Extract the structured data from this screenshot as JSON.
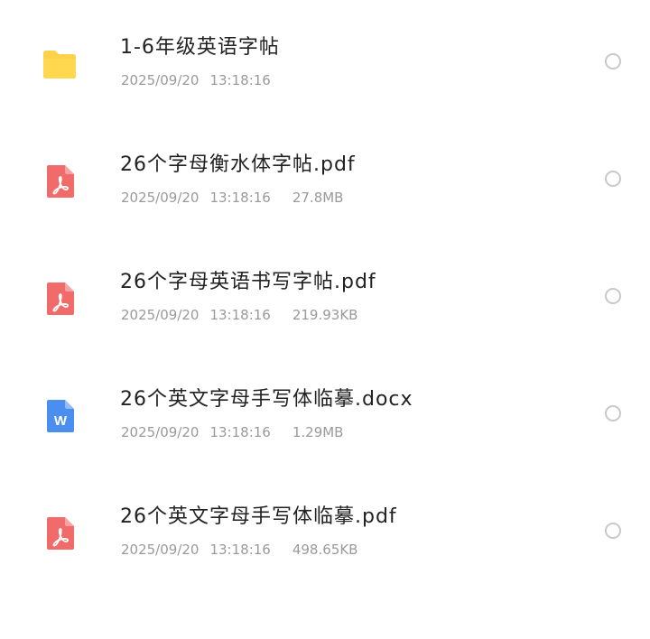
{
  "colors": {
    "folder": "#fdd24a",
    "pdf": "#f26b6b",
    "doc": "#4a8ef0",
    "text_primary": "#222222",
    "text_secondary": "#9a9a9a",
    "radio_border": "#c8c8c8"
  },
  "files": [
    {
      "name": "1-6年级英语字帖",
      "date": "2025/09/20",
      "time": "13:18:16",
      "size": "",
      "icon": "folder-icon"
    },
    {
      "name": "26个字母衡水体字帖.pdf",
      "date": "2025/09/20",
      "time": "13:18:16",
      "size": "27.8MB",
      "icon": "pdf-icon"
    },
    {
      "name": "26个字母英语书写字帖.pdf",
      "date": "2025/09/20",
      "time": "13:18:16",
      "size": "219.93KB",
      "icon": "pdf-icon"
    },
    {
      "name": "26个英文字母手写体临摹.docx",
      "date": "2025/09/20",
      "time": "13:18:16",
      "size": "1.29MB",
      "icon": "word-doc-icon",
      "icon_letter": "W"
    },
    {
      "name": "26个英文字母手写体临摹.pdf",
      "date": "2025/09/20",
      "time": "13:18:16",
      "size": "498.65KB",
      "icon": "pdf-icon"
    }
  ]
}
